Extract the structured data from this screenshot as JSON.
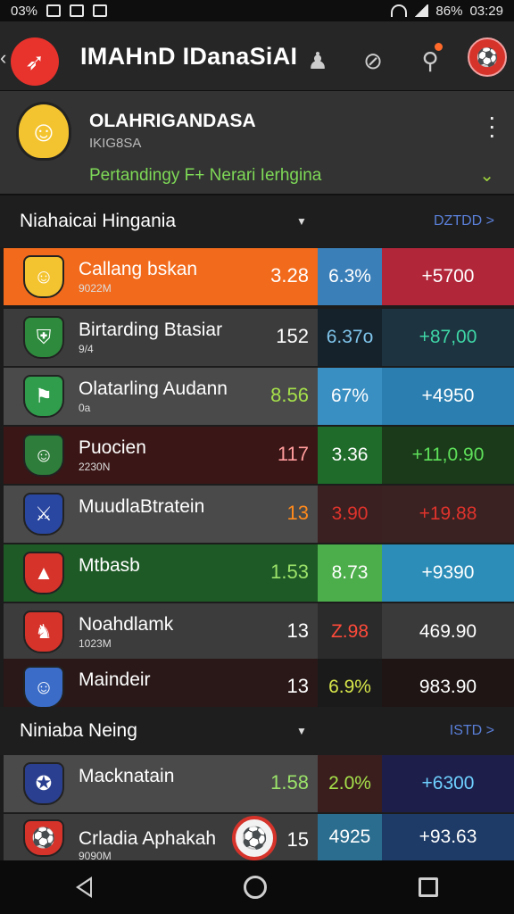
{
  "status": {
    "left_text": "03%",
    "battery": "86%",
    "time": "03:29"
  },
  "appbar": {
    "title": "IMAHnD IDanaSiAI"
  },
  "league": {
    "name": "OLAHRIGANDASA",
    "sub": "IKIG8SA",
    "match_label": "Pertandingy F+ Nerari Ierhgina"
  },
  "section1": {
    "title": "Niahaicai Hingania",
    "link": "DZTDD >"
  },
  "section2": {
    "title": "Niniaba Neing",
    "link": "ISTD >"
  },
  "rows": [
    {
      "team": "Callang bskan",
      "sub": "9022M",
      "n1": "3.28",
      "n2": "6.3%",
      "n3": "+5700"
    },
    {
      "team": "Birtarding Btasiar",
      "sub": "9/4",
      "n1": "152",
      "n2": "6.37o",
      "n3": "+87,00"
    },
    {
      "team": "Olatarling Audann",
      "sub": "0a",
      "n1": "8.56",
      "n2": "67%",
      "n3": "+4950"
    },
    {
      "team": "Puocien",
      "sub": "2230N",
      "n1": "117",
      "n2": "3.36",
      "n3": "+11,0.90"
    },
    {
      "team": "MuudlaBtratein",
      "sub": "",
      "n1": "13",
      "n2": "3.90",
      "n3": "+19.88"
    },
    {
      "team": "Mtbasb",
      "sub": "",
      "n1": "1.53",
      "n2": "8.73",
      "n3": "+9390"
    },
    {
      "team": "Noahdlamk",
      "sub": "1023M",
      "n1": "13",
      "n2": "Z.98",
      "n3": "469.90"
    },
    {
      "team": "Maindeir",
      "sub": "",
      "n1": "13",
      "n2": "6.9%",
      "n3": "983.90"
    },
    {
      "team": "Macknatain",
      "sub": "",
      "n1": "1.58",
      "n2": "2.0%",
      "n3": "+6300"
    },
    {
      "team": "Crladia Aphakah",
      "sub": "9090M",
      "n1": "15",
      "n2": "4925",
      "n3": "+93.63"
    }
  ],
  "colors": {
    "accent_red": "#e8322c",
    "green_text": "#7ed957"
  }
}
